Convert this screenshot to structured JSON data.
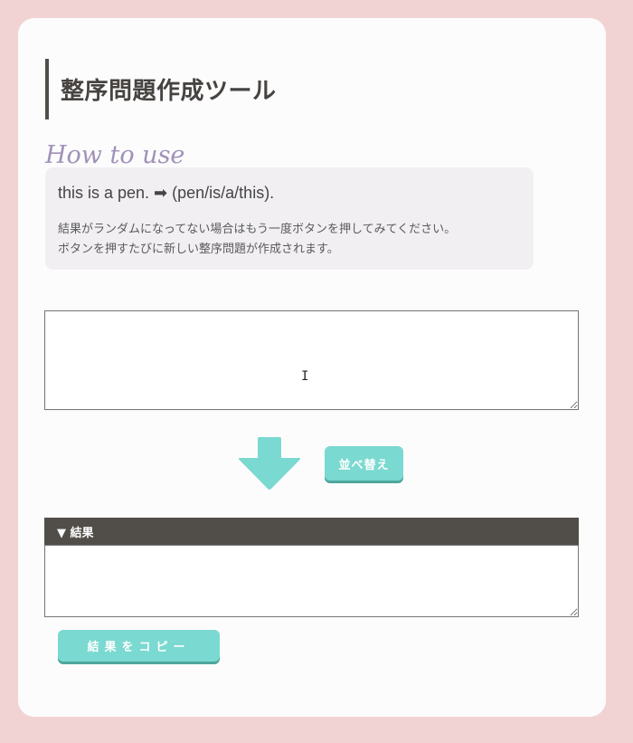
{
  "page": {
    "title": "整序問題作成ツール"
  },
  "how_to": {
    "heading": "How to use",
    "example": "this is a pen. ➡ (pen/is/a/this).",
    "notes": [
      "結果がランダムになってない場合はもう一度ボタンを押してみてください。",
      "ボタンを押すたびに新しい整序問題が作成されます。"
    ]
  },
  "input": {
    "value": "",
    "placeholder": ""
  },
  "sort_button": {
    "label": "並べ替え"
  },
  "result": {
    "header": "▼ 結果",
    "value": ""
  },
  "copy_button": {
    "label": "結果をコピー"
  },
  "icons": {
    "arrow": "arrow-down-icon",
    "cursor": "text-cursor-icon"
  },
  "colors": {
    "background": "#f2d3d3",
    "card": "#fdfcfd",
    "accent": "#7ad9d0",
    "accent_shadow": "#4ea79d",
    "header_bar": "#514e4a",
    "how_to_heading": "#a092b8",
    "info_box": "#f1eff2"
  }
}
